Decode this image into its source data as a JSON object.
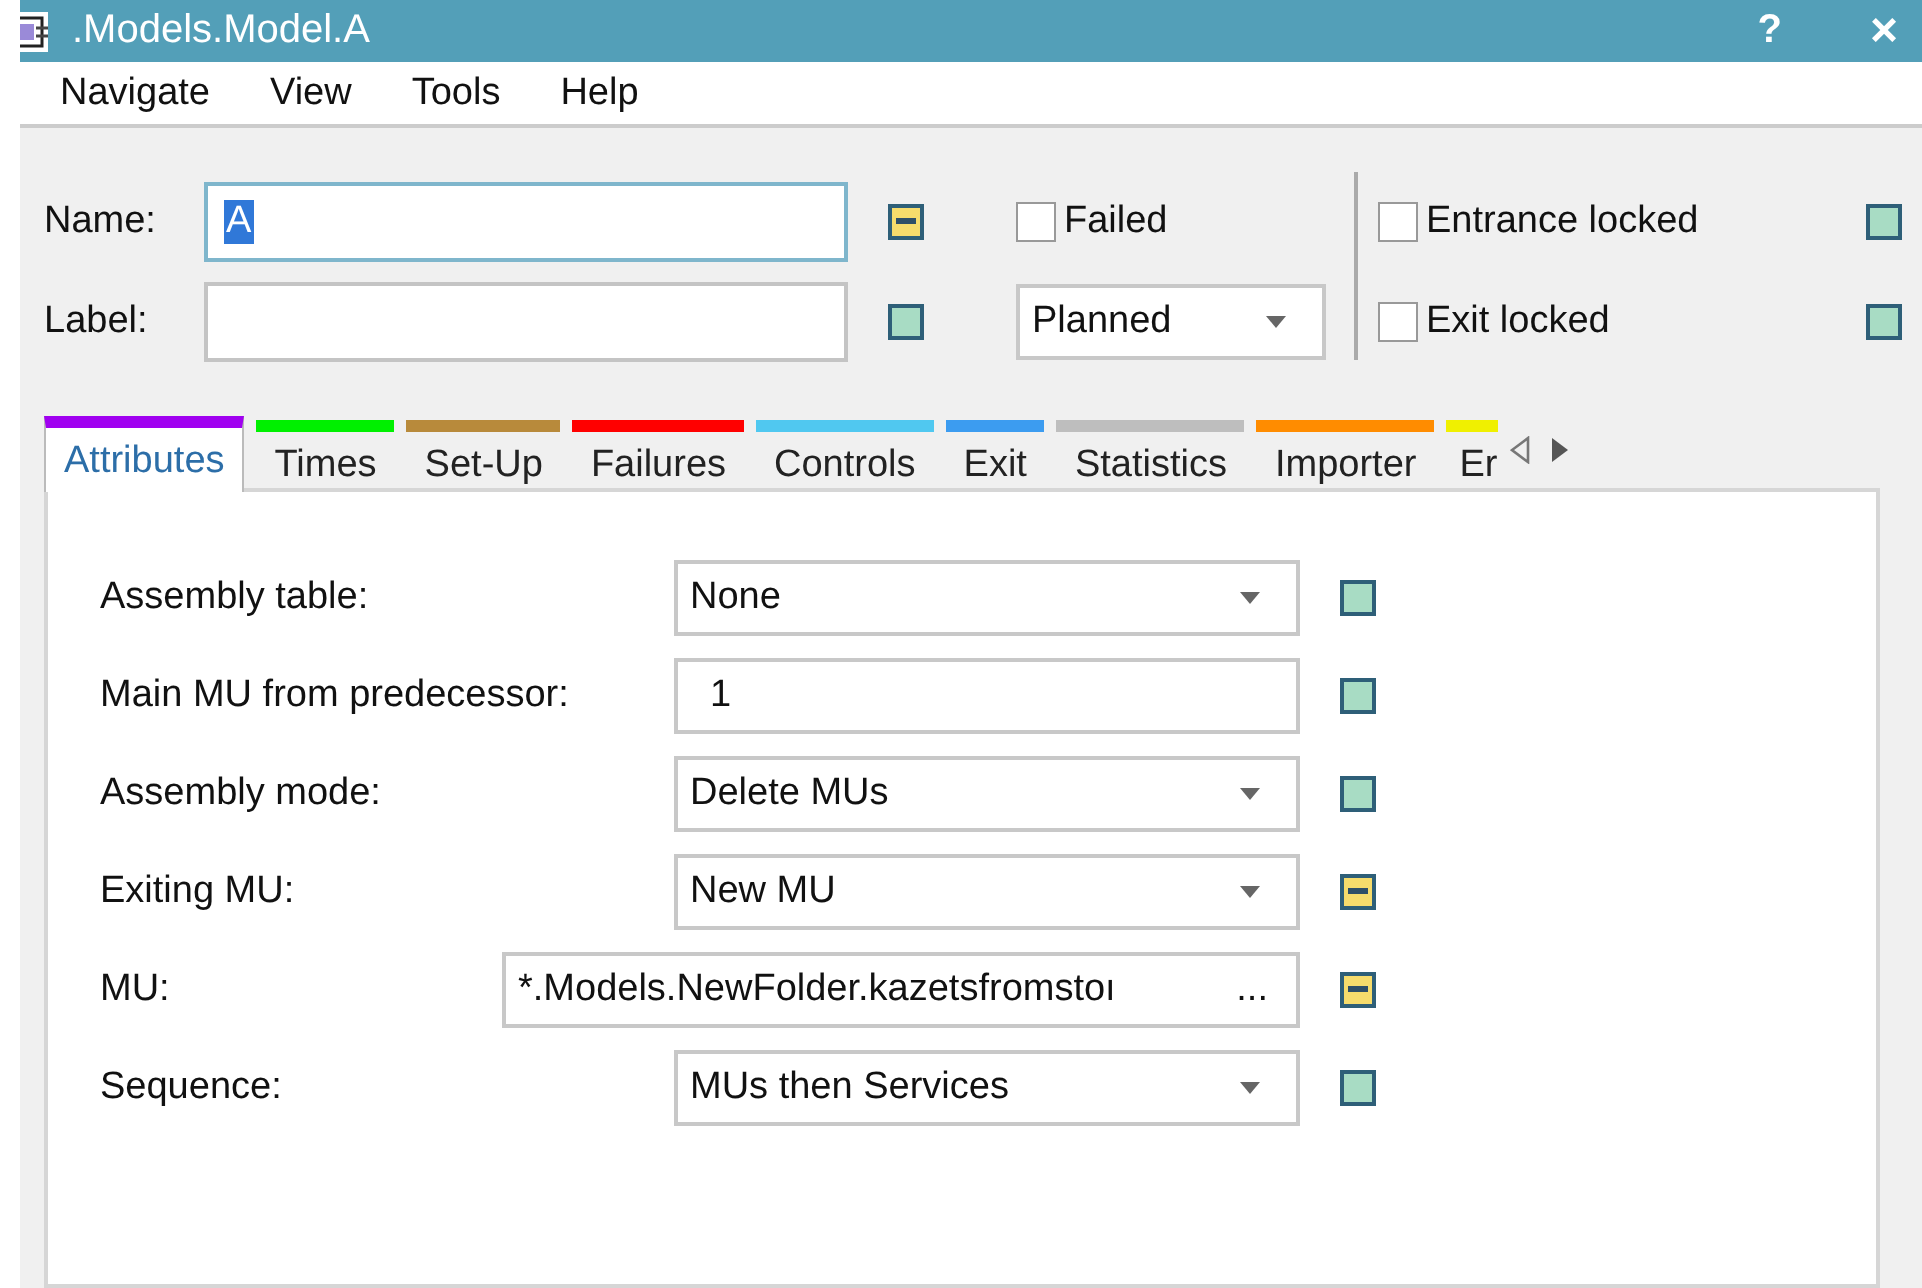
{
  "window": {
    "title": ".Models.Model.A",
    "help_button": "?",
    "close_button": "×"
  },
  "menu": [
    "Navigate",
    "View",
    "Tools",
    "Help"
  ],
  "header": {
    "name": {
      "label": "Name:",
      "value": "A",
      "inherited": false
    },
    "label": {
      "label": "Label:",
      "inherited": true
    },
    "failed": {
      "label": "Failed",
      "checked": false
    },
    "state": {
      "value": "Planned"
    },
    "entrance_locked": {
      "label": "Entrance locked",
      "checked": false,
      "inherited": true
    },
    "exit_locked": {
      "label": "Exit locked",
      "checked": false,
      "inherited": true
    }
  },
  "tabs": [
    {
      "label": "Attributes",
      "selected": true,
      "color": "#a000f0"
    },
    {
      "label": "Times",
      "selected": false,
      "color": "#00f000"
    },
    {
      "label": "Set-Up",
      "selected": false,
      "color": "#b88a3b"
    },
    {
      "label": "Failures",
      "selected": false,
      "color": "#ff0000"
    },
    {
      "label": "Controls",
      "selected": false,
      "color": "#50c8f0"
    },
    {
      "label": "Exit",
      "selected": false,
      "color": "#3c9cf0"
    },
    {
      "label": "Statistics",
      "selected": false,
      "color": "#bebebe"
    },
    {
      "label": "Importer",
      "selected": false,
      "color": "#ff8c00"
    },
    {
      "label": "Er",
      "selected": false,
      "color": "#f0f000"
    }
  ],
  "attributes": [
    {
      "label": "Assembly table:",
      "kind": "dropdown",
      "value": "None",
      "inherited": true
    },
    {
      "label": "Main MU from predecessor:",
      "kind": "text",
      "value": "1",
      "inherited": true
    },
    {
      "label": "Assembly mode:",
      "kind": "dropdown",
      "value": "Delete MUs",
      "inherited": true
    },
    {
      "label": "Exiting MU:",
      "kind": "dropdown",
      "value": "New MU",
      "inherited": false
    },
    {
      "label": "MU:",
      "kind": "reference",
      "value": "*.Models.NewFolder.kazetsfromstoı",
      "button": "...",
      "inherited": false
    },
    {
      "label": "Sequence:",
      "kind": "dropdown",
      "value": "MUs then Services",
      "inherited": true
    }
  ]
}
